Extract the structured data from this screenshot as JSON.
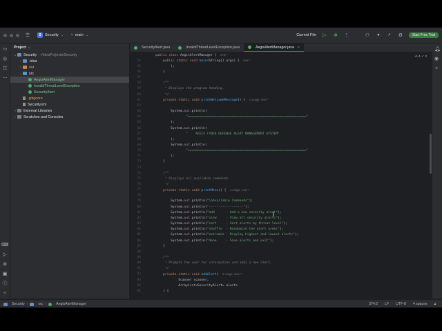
{
  "titlebar": {
    "project_name": "Security",
    "branch": "main",
    "run_config": "Current File",
    "trial_button": "Start Free Trial"
  },
  "project_panel": {
    "title": "Project",
    "items": [
      {
        "label": "Security",
        "muted": "~/IdeaProjects/Security",
        "indent": 0,
        "kind": "folder",
        "chev": "v"
      },
      {
        "label": ".idea",
        "indent": 1,
        "kind": "folder",
        "chev": ">"
      },
      {
        "label": "out",
        "indent": 1,
        "kind": "folder-orange",
        "chev": ">"
      },
      {
        "label": "src",
        "indent": 1,
        "kind": "folder-blue",
        "chev": "v"
      },
      {
        "label": "AegisAlertManager",
        "indent": 2,
        "kind": "class"
      },
      {
        "label": "InvalidThreatLevelException",
        "indent": 2,
        "kind": "class"
      },
      {
        "label": "SecurityAlert",
        "indent": 2,
        "kind": "class"
      },
      {
        "label": ".gitignore",
        "indent": 1,
        "kind": "file"
      },
      {
        "label": "Security.iml",
        "indent": 1,
        "kind": "file"
      },
      {
        "label": "External Libraries",
        "indent": 0,
        "kind": "lib",
        "chev": ">"
      },
      {
        "label": "Scratches and Consoles",
        "indent": 0,
        "kind": "scratch",
        "chev": ">"
      }
    ]
  },
  "tabs": [
    {
      "label": "SecurityAlert.java",
      "active": false
    },
    {
      "label": "InvalidThreatLevelException.java",
      "active": false
    },
    {
      "label": "AegisAlertManager.java",
      "active": true
    }
  ],
  "editor": {
    "inspection": "⚠ 4  ✓ 2",
    "lines": [
      {
        "n": "",
        "html": "<span class='kw'>public class</span> AegisAlertManager {  <span class='hint'>new *</span>"
      },
      {
        "n": "54",
        "html": "    <span class='kw'>public static void</span> <span class='fn'>main</span>(String[] args) {  <span class='hint'>new *</span>"
      },
      {
        "n": "55",
        "html": "        );"
      },
      {
        "n": "56",
        "html": "    }"
      },
      {
        "n": "57",
        "html": ""
      },
      {
        "n": "58",
        "html": "    <span class='cm'>/**</span>"
      },
      {
        "n": "59",
        "html": "    <span class='cm'> * Displays the program heading.</span>"
      },
      {
        "n": "60",
        "html": "    <span class='cm'> */</span>"
      },
      {
        "n": "61",
        "html": "    <span class='kw'>private static void</span> <span class='fn'>printWelcomeMessage</span>() {  <span class='hint'>1 usage  new *</span>"
      },
      {
        "n": "62",
        "html": ""
      },
      {
        "n": "63",
        "html": "        System.<span class='fld'>out</span>.println("
      },
      {
        "n": "64",
        "html": "                <span class='str'>\"==============================================================\"</span>"
      },
      {
        "n": "65",
        "html": "        );"
      },
      {
        "n": "66",
        "html": "        System.<span class='fld'>out</span>.println("
      },
      {
        "n": "67",
        "html": "                <span class='str'>\"    AEGIS CYBER DEFENSE ALERT MANAGEMENT SYSTEM\"</span>"
      },
      {
        "n": "68",
        "html": "        );"
      },
      {
        "n": "69",
        "html": "        System.<span class='fld'>out</span>.println("
      },
      {
        "n": "70",
        "html": "                <span class='str'>\"==============================================================\"</span>"
      },
      {
        "n": "71",
        "html": "        );"
      },
      {
        "n": "72",
        "html": "    }"
      },
      {
        "n": "73",
        "html": ""
      },
      {
        "n": "74",
        "html": "    <span class='cm'>/**</span>"
      },
      {
        "n": "75",
        "html": "    <span class='cm'> * Displays all available commands.</span>"
      },
      {
        "n": "76",
        "html": "    <span class='cm'> */</span>"
      },
      {
        "n": "77",
        "html": "    <span class='kw'>private static void</span> <span class='fn'>printMenu</span>() {  <span class='hint'>1 usage  new *</span>"
      },
      {
        "n": "78",
        "html": ""
      },
      {
        "n": "79",
        "html": "        System.<span class='fld'>out</span>.println(<span class='str'>\"\\nAvailable Commands\"</span>);"
      },
      {
        "n": "80",
        "html": "        System.<span class='fld'>out</span>.println(<span class='str'>\"------------------\"</span>);"
      },
      {
        "n": "81",
        "html": "        System.<span class='fld'>out</span>.println(<span class='str'>\"add      - Add a new security alert\"</span>);"
      },
      {
        "n": "82",
        "html": "        System.<span class='fld'>out</span>.println(<span class='str'>\"view     - View all security alerts\"</span>);"
      },
      {
        "n": "83",
        "html": "        System.<span class='fld'>out</span>.println(<span class='str'>\"sort     - Sort alerts by threat level\"</span>);"
      },
      {
        "n": "84",
        "html": "        System.<span class='fld'>out</span>.println(<span class='str'>\"shuffle  - Randomize the alert order\"</span>);"
      },
      {
        "n": "85",
        "html": "        System.<span class='fld'>out</span>.println(<span class='str'>\"extremes - Display highest and lowest alerts\"</span>);"
      },
      {
        "n": "86",
        "html": "        System.<span class='fld'>out</span>.println(<span class='str'>\"done     - Save alerts and exit\"</span>);"
      },
      {
        "n": "87",
        "html": "    }"
      },
      {
        "n": "88",
        "html": ""
      },
      {
        "n": "89",
        "html": "    <span class='cm'>/**</span>"
      },
      {
        "n": "90",
        "html": "    <span class='cm'> * Prompts the user for information and adds a new alert.</span>"
      },
      {
        "n": "91",
        "html": "    <span class='cm'> */</span>"
      },
      {
        "n": "92",
        "html": "    <span class='kw'>private static void</span> <span class='fn'>addAlert</span>(  <span class='hint'>1 usage  new *</span>"
      },
      {
        "n": "93",
        "html": "            Scanner scanner,"
      },
      {
        "n": "94",
        "html": "            ArrayList&lt;SecurityAlert&gt; alerts"
      },
      {
        "n": "95",
        "html": "    ) {"
      }
    ]
  },
  "statusbar": {
    "crumbs": [
      "Security",
      "src",
      "AegisAlertManager"
    ],
    "position": "374:2",
    "line_sep": "LF",
    "encoding": "UTF-8",
    "indent": "4 spaces"
  }
}
